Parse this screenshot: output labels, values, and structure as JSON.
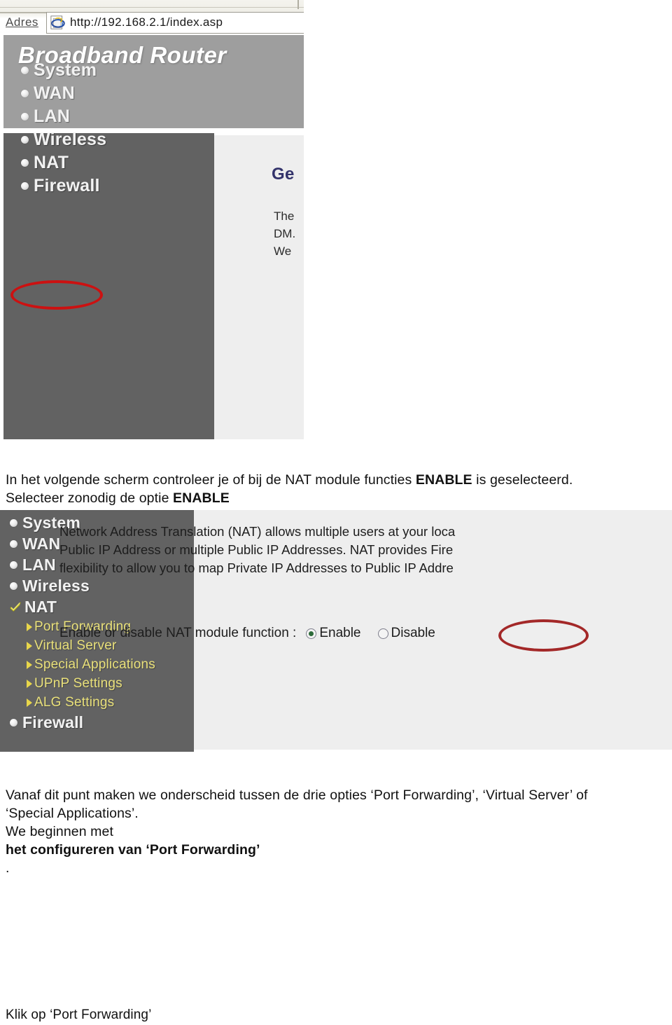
{
  "browser": {
    "address_label": "Adres",
    "url": "http://192.168.2.1/index.asp",
    "icon": "internet-explorer-icon"
  },
  "screenshot1": {
    "banner_title": "Broadband Router",
    "nav_items": [
      {
        "label": "System",
        "bullet": "dot-bullet-icon"
      },
      {
        "label": "WAN",
        "bullet": "dot-bullet-icon"
      },
      {
        "label": "LAN",
        "bullet": "dot-bullet-icon"
      },
      {
        "label": "Wireless",
        "bullet": "dot-bullet-icon"
      },
      {
        "label": "NAT",
        "bullet": "dot-bullet-icon",
        "highlighted": true
      },
      {
        "label": "Firewall",
        "bullet": "dot-bullet-icon"
      }
    ],
    "content_heading_clipped": "Ge",
    "content_lines_clipped": [
      "The",
      "DM.",
      "We"
    ],
    "annotation_color": "#cc1111"
  },
  "paragraph1": {
    "line1_a": "In het volgende scherm controleer je of bij de NAT module functies ",
    "line1_bold": "ENABLE",
    "line1_b": " is geselecteerd.",
    "line2_a": "Selecteer zonodig de optie ",
    "line2_bold": "ENABLE"
  },
  "screenshot2": {
    "nav_items": [
      {
        "label": "System",
        "bullet": "dot-bullet-icon"
      },
      {
        "label": "WAN",
        "bullet": "dot-bullet-icon"
      },
      {
        "label": "LAN",
        "bullet": "dot-bullet-icon"
      },
      {
        "label": "Wireless",
        "bullet": "dot-bullet-icon"
      },
      {
        "label": "NAT",
        "bullet": "checkmark-icon",
        "selected": true
      },
      {
        "label": "Firewall",
        "bullet": "dot-bullet-icon"
      }
    ],
    "sub_items": [
      {
        "label": "Port Forwarding",
        "bullet": "arrow-bullet-icon"
      },
      {
        "label": "Virtual Server",
        "bullet": "arrow-bullet-icon"
      },
      {
        "label": "Special Applications",
        "bullet": "arrow-bullet-icon"
      },
      {
        "label": "UPnP Settings",
        "bullet": "arrow-bullet-icon"
      },
      {
        "label": "ALG Settings",
        "bullet": "arrow-bullet-icon"
      }
    ],
    "description_lines": [
      "Network Address Translation (NAT) allows multiple users at your loca",
      "Public IP Address or multiple Public IP Addresses. NAT provides Fire",
      "flexibility to allow you to map Private IP Addresses to Public IP Addre"
    ],
    "setting_label": "Enable or disable NAT module function :",
    "option_enable": "Enable",
    "option_disable": "Disable",
    "selected_option": "Enable",
    "annotation_color": "#a32828"
  },
  "paragraph2": {
    "line1": "Vanaf dit punt maken we onderscheid tussen de drie opties ‘Port Forwarding’, ‘Virtual Server’ of",
    "line2": "‘Special Applications’.",
    "line3_a": "We beginnen met ",
    "line3_bold": "het configureren van ‘Port Forwarding’",
    "line3_b": "."
  },
  "paragraph3": {
    "text": "Klik op ‘Port Forwarding’"
  },
  "colors": {
    "sidebar_bg": "#626262",
    "banner_bg": "#9e9e9e",
    "content_bg": "#eeeeee",
    "sub_item_text": "#e9e07a",
    "annotation_red": "#cc1111"
  }
}
